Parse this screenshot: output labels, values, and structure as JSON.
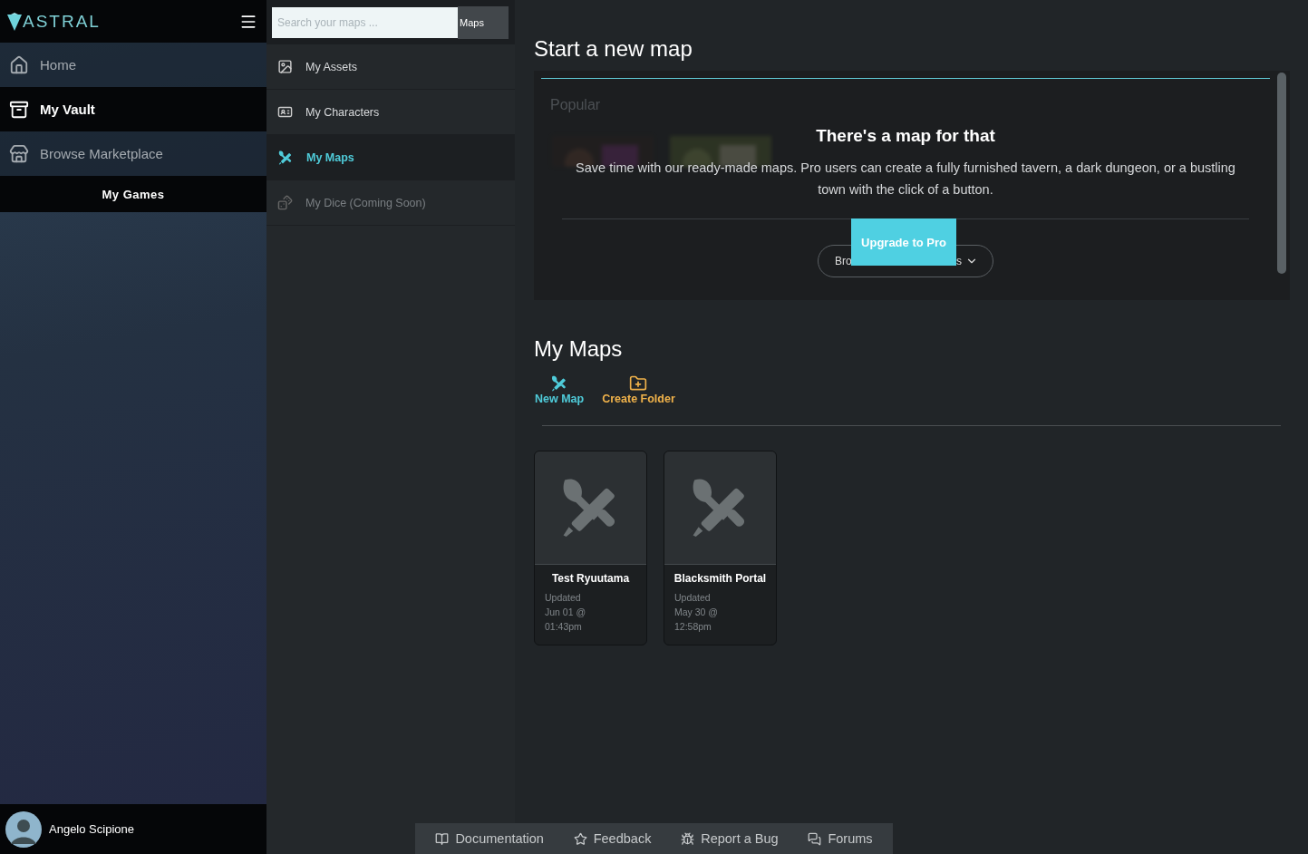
{
  "logo": {
    "text": "ASTRAL"
  },
  "sidebar": {
    "items": [
      {
        "label": "Home",
        "selected": false
      },
      {
        "label": "My Vault",
        "selected": true
      },
      {
        "label": "Browse Marketplace",
        "selected": false
      }
    ],
    "games_button": "My Games",
    "user": {
      "name": "Angelo Scipione"
    }
  },
  "search": {
    "placeholder": "Search your maps ...",
    "scope": "Maps"
  },
  "vault_menu": [
    {
      "label": "My Assets",
      "selected": false,
      "disabled": false
    },
    {
      "label": "My Characters",
      "selected": false,
      "disabled": false
    },
    {
      "label": "My Maps",
      "selected": true,
      "disabled": false
    },
    {
      "label": "My Dice (Coming Soon)",
      "selected": false,
      "disabled": true
    }
  ],
  "new_map": {
    "title": "Start a new map",
    "section": "Popular",
    "promo_title": "There's a map for that",
    "promo_text": "Save time with our ready-made maps. Pro users can create a fully furnished tavern, a dark dungeon, or a bustling town with the click of a button.",
    "browse_start": "Bro",
    "browse_end": "s",
    "upgrade_button": "Upgrade to Pro"
  },
  "my_maps": {
    "title": "My Maps",
    "actions": [
      {
        "label": "New Map",
        "kind": "map"
      },
      {
        "label": "Create Folder",
        "kind": "folder"
      }
    ],
    "maps": [
      {
        "name": "Test Ryuutama",
        "updated": "Updated",
        "date": "Jun 01 @",
        "time": "01:43pm"
      },
      {
        "name": "Blacksmith Portal",
        "updated": "Updated",
        "date": "May 30 @",
        "time": "12:58pm"
      }
    ]
  },
  "footer": [
    {
      "label": "Documentation"
    },
    {
      "label": "Feedback"
    },
    {
      "label": "Report a Bug"
    },
    {
      "label": "Forums"
    }
  ]
}
